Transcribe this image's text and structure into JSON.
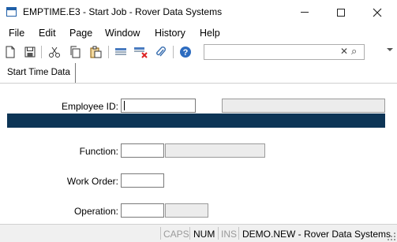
{
  "window": {
    "title": "EMPTIME.E3 - Start Job - Rover Data Systems"
  },
  "menu": {
    "items": [
      "File",
      "Edit",
      "Page",
      "Window",
      "History",
      "Help"
    ]
  },
  "toolbar": {
    "icons": [
      "new-document-icon",
      "save-icon",
      "cut-icon",
      "copy-icon",
      "paste-icon",
      "insert-row-icon",
      "delete-row-icon",
      "attach-icon",
      "help-icon"
    ],
    "search_value": "",
    "search_clear_glyph": "✕",
    "search_go_glyph": "⌕"
  },
  "tabs": {
    "active_label": "Start Time Data"
  },
  "form": {
    "employee_id_label": "Employee ID:",
    "employee_id_value": "",
    "employee_name_value": "",
    "function_label": "Function:",
    "function_value": "",
    "function_desc_value": "",
    "work_order_label": "Work Order:",
    "work_order_value": "",
    "operation_label": "Operation:",
    "operation_value": "",
    "operation_desc_value": ""
  },
  "status": {
    "caps": "CAPS",
    "num": "NUM",
    "ins": "INS",
    "account": "DEMO.NEW - Rover Data Systems"
  },
  "colors": {
    "band": "#0d3556",
    "accent": "#1f5fa8"
  }
}
